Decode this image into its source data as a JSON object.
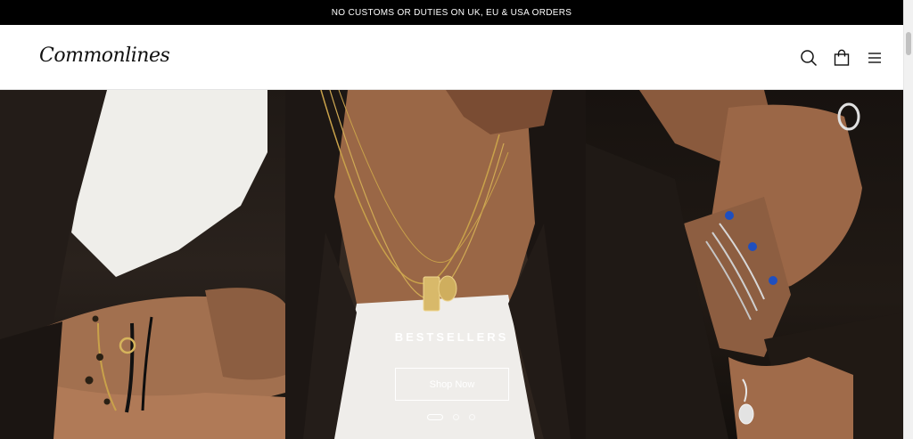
{
  "announcement": {
    "text": "NO CUSTOMS OR DUTIES ON UK, EU & USA ORDERS"
  },
  "header": {
    "logo": "Commonlines",
    "icons": [
      "search-icon",
      "bag-icon",
      "menu-icon"
    ]
  },
  "hero": {
    "title": "BESTSELLERS",
    "button_label": "Shop Now",
    "slides_total": 3,
    "active_slide": 1
  }
}
